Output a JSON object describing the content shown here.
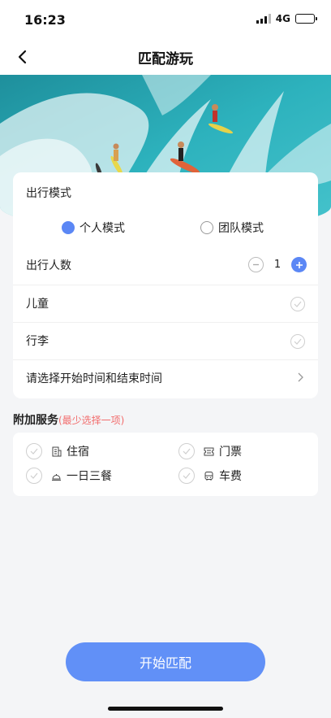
{
  "status_bar": {
    "time": "16:23",
    "network": "4G",
    "icons": [
      "signal-icon",
      "battery-icon"
    ]
  },
  "nav": {
    "title": "匹配游玩",
    "back_icon": "chevron-left-icon"
  },
  "hero": {
    "image": "surfers-on-wave-photo"
  },
  "mode_card": {
    "title": "出行模式",
    "options": [
      {
        "label": "个人模式",
        "selected": true
      },
      {
        "label": "团队模式",
        "selected": false
      }
    ],
    "travelers": {
      "label": "出行人数",
      "count": "1"
    },
    "children": {
      "label": "儿童"
    },
    "luggage": {
      "label": "行李"
    },
    "time_select": {
      "label": "请选择开始时间和结束时间"
    }
  },
  "extra_services": {
    "title": "附加服务",
    "hint": "(最少选择一项)",
    "items": [
      {
        "label": "住宿",
        "icon": "hotel-icon"
      },
      {
        "label": "门票",
        "icon": "ticket-icon"
      },
      {
        "label": "一日三餐",
        "icon": "meal-bell-icon"
      },
      {
        "label": "车费",
        "icon": "bus-icon"
      }
    ]
  },
  "start_button": {
    "label": "开始匹配"
  },
  "colors": {
    "accent": "#5b87f5",
    "button": "#6190f7",
    "hint": "#f26d6d",
    "background": "#f4f5f7"
  }
}
